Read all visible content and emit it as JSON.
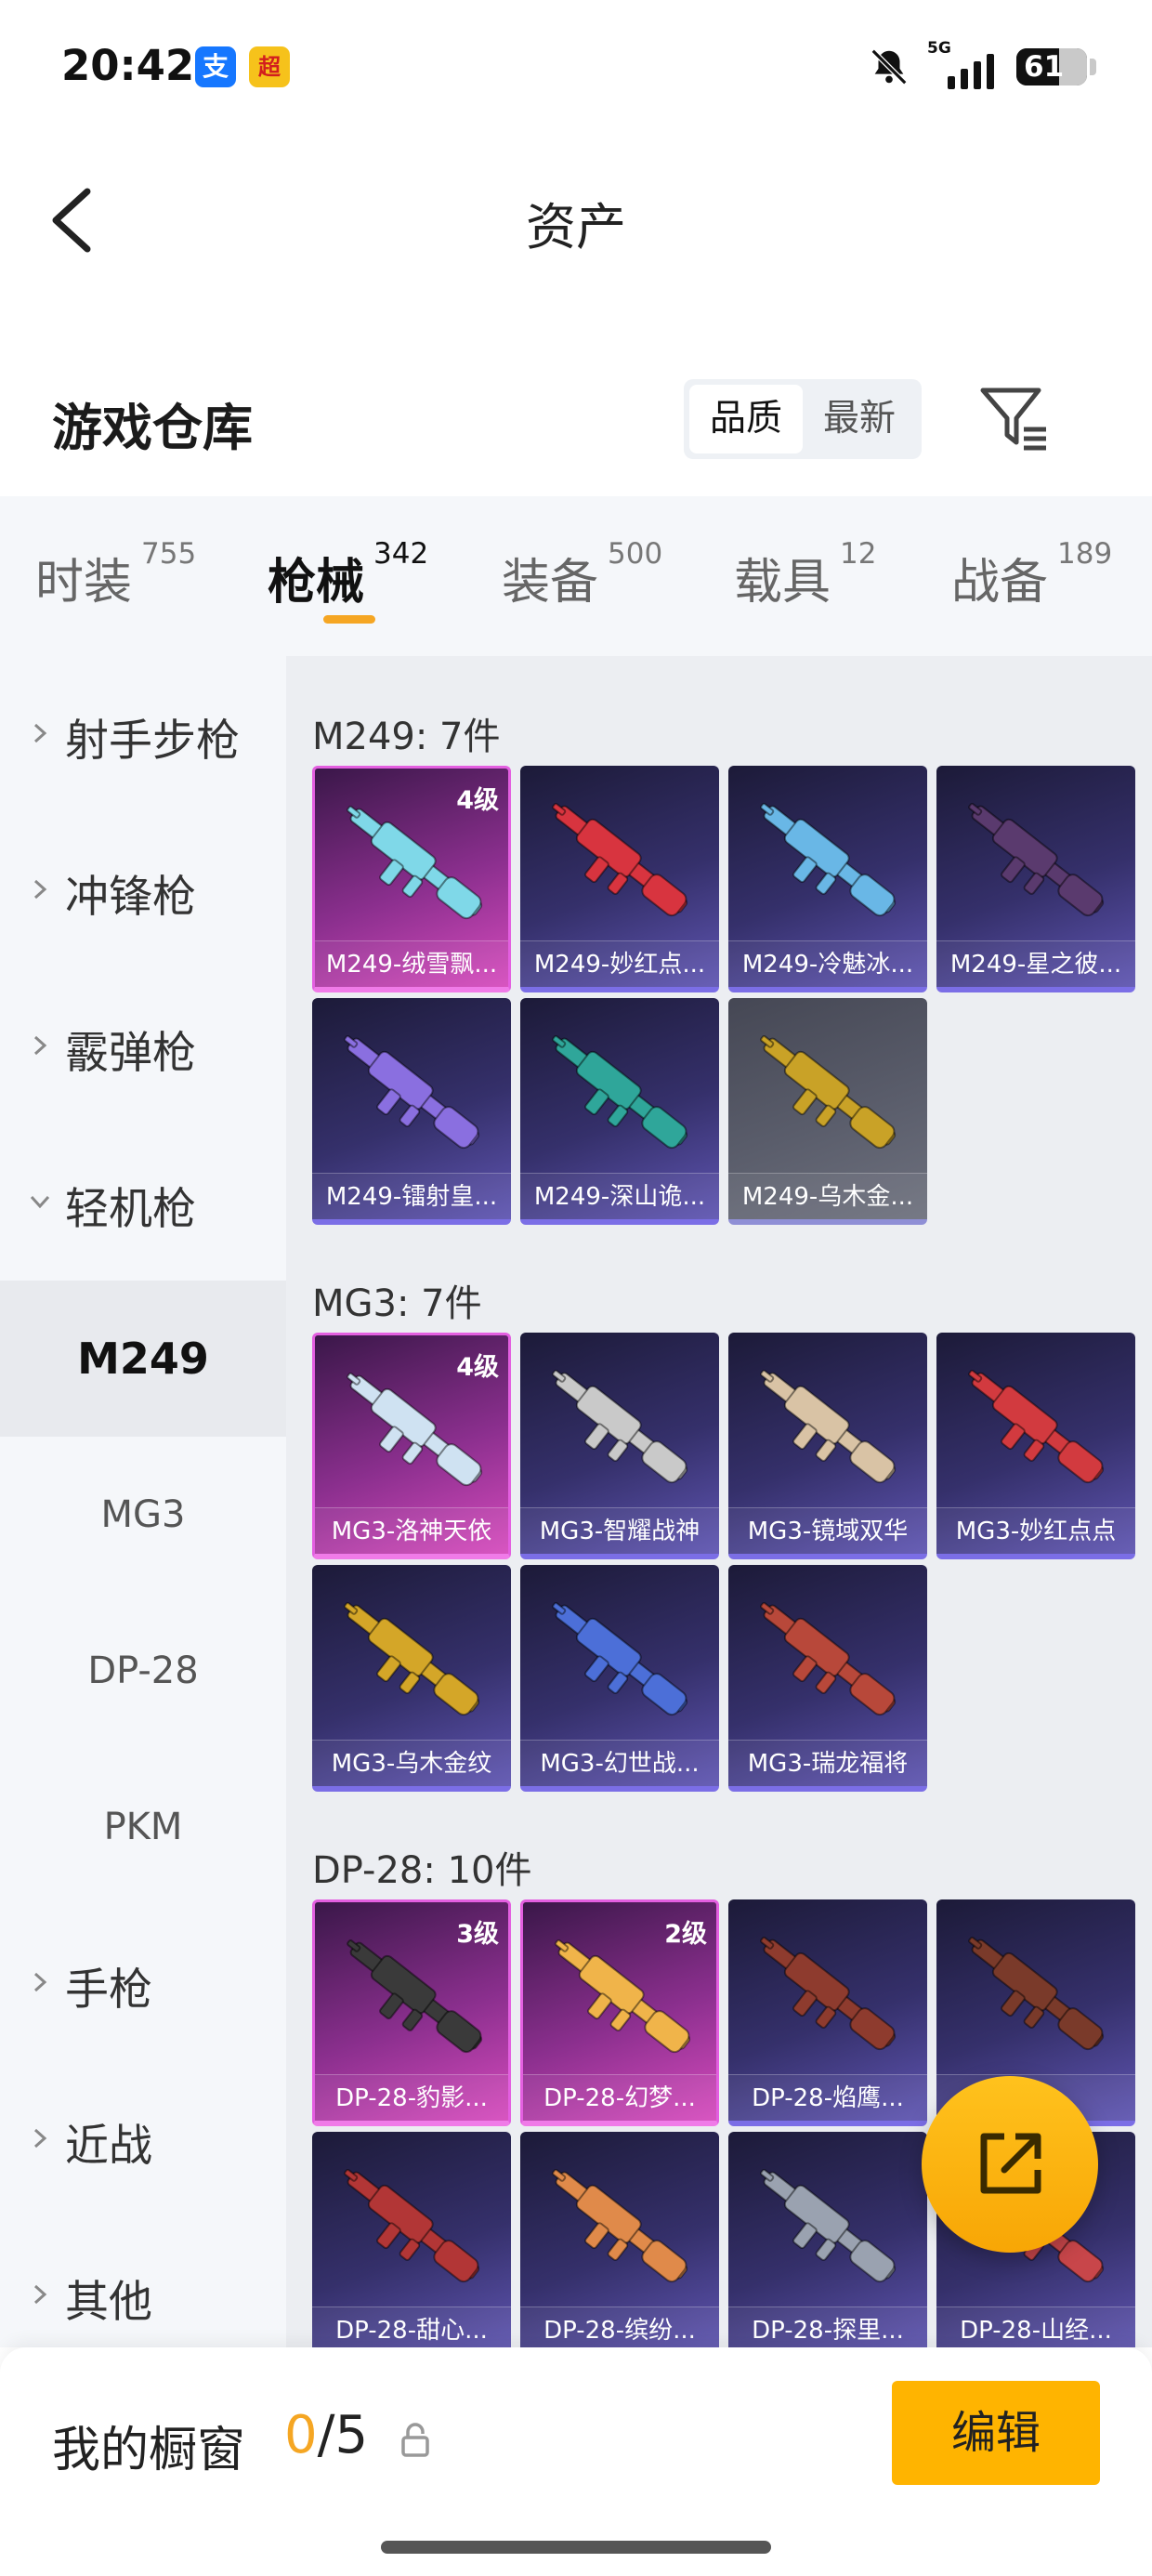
{
  "status_bar": {
    "time": "20:42",
    "apps": [
      {
        "icon": "alipay-icon",
        "glyph": "支",
        "color": "#1677ff"
      },
      {
        "icon": "game-app-icon",
        "glyph": "超",
        "color": "#f6c21b"
      }
    ],
    "network": "5G",
    "battery_level": "61",
    "battery_fraction": 0.61
  },
  "header": {
    "title": "资产",
    "back_icon": "chevron-left-icon"
  },
  "warehouse": {
    "title": "游戏仓库",
    "sort_options": [
      "品质",
      "最新"
    ],
    "sort_selected": "品质",
    "filter_icon": "filter-list-icon"
  },
  "tabs": [
    {
      "label": "时装",
      "count": "755"
    },
    {
      "label": "枪械",
      "count": "342",
      "active": true
    },
    {
      "label": "装备",
      "count": "500"
    },
    {
      "label": "载具",
      "count": "12"
    },
    {
      "label": "战备",
      "count": "189"
    }
  ],
  "sidebar": {
    "categories": [
      {
        "label": "射手步枪",
        "expanded": false
      },
      {
        "label": "冲锋枪",
        "expanded": false
      },
      {
        "label": "霰弹枪",
        "expanded": false
      },
      {
        "label": "轻机枪",
        "expanded": true
      },
      {
        "label": "手枪",
        "expanded": false
      },
      {
        "label": "近战",
        "expanded": false
      },
      {
        "label": "其他",
        "expanded": false
      }
    ],
    "sub_items": [
      "M249",
      "MG3",
      "DP-28",
      "PKM"
    ],
    "sub_selected": "M249"
  },
  "groups": [
    {
      "title": "M249: 7件",
      "items": [
        {
          "name": "M249-绒雪飘...",
          "level": "4级",
          "rarity": "legend",
          "color": "#7fd8e8"
        },
        {
          "name": "M249-妙红点...",
          "rarity": "epic",
          "color": "#d8343f"
        },
        {
          "name": "M249-冷魅冰...",
          "rarity": "epic",
          "color": "#69b7e6"
        },
        {
          "name": "M249-星之彼...",
          "rarity": "epic",
          "color": "#5a3a6e"
        },
        {
          "name": "M249-镭射皇...",
          "rarity": "epic",
          "color": "#8a6fe0"
        },
        {
          "name": "M249-深山诡...",
          "rarity": "epic",
          "color": "#2fa69a"
        },
        {
          "name": "M249-乌木金...",
          "rarity": "rare",
          "color": "#c9a227"
        }
      ]
    },
    {
      "title": "MG3: 7件",
      "items": [
        {
          "name": "MG3-洛神天依",
          "level": "4级",
          "rarity": "legend",
          "color": "#cfe2f2"
        },
        {
          "name": "MG3-智耀战神",
          "rarity": "epic",
          "color": "#c9c9c9"
        },
        {
          "name": "MG3-镜域双华",
          "rarity": "epic",
          "color": "#d9c3a5"
        },
        {
          "name": "MG3-妙红点点",
          "rarity": "epic",
          "color": "#d23a3f"
        },
        {
          "name": "MG3-乌木金纹",
          "rarity": "epic",
          "color": "#d4a628"
        },
        {
          "name": "MG3-幻世战...",
          "rarity": "epic",
          "color": "#4c6fd8"
        },
        {
          "name": "MG3-瑞龙福将",
          "rarity": "epic",
          "color": "#b8483a"
        }
      ]
    },
    {
      "title": "DP-28: 10件",
      "items": [
        {
          "name": "DP-28-豹影...",
          "level": "3级",
          "rarity": "legend",
          "color": "#3a3a3a"
        },
        {
          "name": "DP-28-幻梦...",
          "level": "2级",
          "rarity": "legend",
          "color": "#f0b44a"
        },
        {
          "name": "DP-28-焰鹰...",
          "rarity": "epic",
          "color": "#8e3b2e"
        },
        {
          "name": "",
          "rarity": "epic",
          "color": "#7a3a2a"
        },
        {
          "name": "DP-28-甜心...",
          "rarity": "epic",
          "color": "#b23636"
        },
        {
          "name": "DP-28-缤纷...",
          "rarity": "epic",
          "color": "#e08a4a"
        },
        {
          "name": "DP-28-探里...",
          "rarity": "epic",
          "color": "#9aa2b0"
        },
        {
          "name": "DP-28-山经...",
          "rarity": "epic",
          "color": "#c8464a"
        }
      ]
    }
  ],
  "share_icon": "share-external-icon",
  "bottom": {
    "label": "我的橱窗",
    "used": "0",
    "total": "/5",
    "lock_icon": "lock-icon",
    "edit_label": "编辑"
  }
}
